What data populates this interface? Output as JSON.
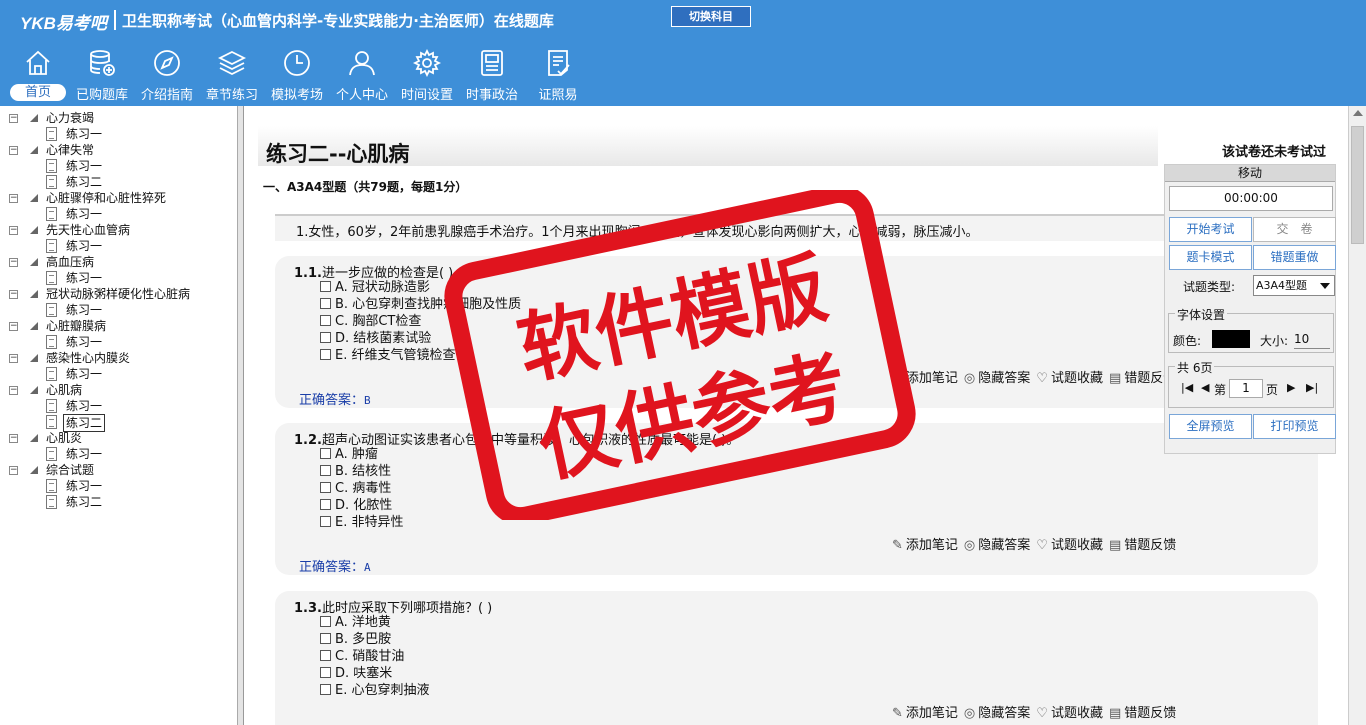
{
  "app": {
    "logo": "YKB易考吧",
    "title": "卫生职称考试（心血管内科学-专业实践能力·主治医师）在线题库",
    "switch_label": "切换科目"
  },
  "nav": [
    {
      "label": "首页",
      "icon": "home-icon"
    },
    {
      "label": "已购题库",
      "icon": "database-icon"
    },
    {
      "label": "介绍指南",
      "icon": "compass-icon"
    },
    {
      "label": "章节练习",
      "icon": "layers-icon"
    },
    {
      "label": "模拟考场",
      "icon": "clock-icon"
    },
    {
      "label": "个人中心",
      "icon": "user-icon"
    },
    {
      "label": "时间设置",
      "icon": "gear-icon"
    },
    {
      "label": "时事政治",
      "icon": "news-icon"
    },
    {
      "label": "证照易",
      "icon": "checklist-icon"
    }
  ],
  "tree": [
    {
      "label": "心力衰竭",
      "children": [
        "练习一"
      ]
    },
    {
      "label": "心律失常",
      "children": [
        "练习一",
        "练习二"
      ]
    },
    {
      "label": "心脏骤停和心脏性猝死",
      "children": [
        "练习一"
      ]
    },
    {
      "label": "先天性心血管病",
      "children": [
        "练习一"
      ]
    },
    {
      "label": "高血压病",
      "children": [
        "练习一"
      ]
    },
    {
      "label": "冠状动脉粥样硬化性心脏病",
      "children": [
        "练习一"
      ]
    },
    {
      "label": "心脏瓣膜病",
      "children": [
        "练习一"
      ]
    },
    {
      "label": "感染性心内膜炎",
      "children": [
        "练习一"
      ]
    },
    {
      "label": "心肌病",
      "children": [
        "练习一",
        "练习二"
      ]
    },
    {
      "label": "心肌炎",
      "children": [
        "练习一"
      ]
    },
    {
      "label": "综合试题",
      "children": [
        "练习一",
        "练习二"
      ]
    }
  ],
  "exam": {
    "title": "练习二--心肌病",
    "status": "该试卷还未考试过",
    "section": "一、A3A4型题（共79题，每题1分）",
    "stem": "1.女性，60岁，2年前患乳腺癌手术治疗。1个月来出现胸闷、气短，查体发现心影向两侧扩大，心音减弱，脉压减小。",
    "questions": [
      {
        "num": "1.1.",
        "text": "进一步应做的检查是( )。",
        "options": [
          "A. 冠状动脉造影",
          "B. 心包穿刺查找肿瘤细胞及性质",
          "C. 胸部CT检查",
          "D. 结核菌素试验",
          "E. 纤维支气管镜检查"
        ],
        "answer": "B"
      },
      {
        "num": "1.2.",
        "text": "超声心动图证实该患者心包呈中等量积液，心包积液的性质最可能是( )。",
        "options": [
          "A. 肿瘤",
          "B. 结核性",
          "C. 病毒性",
          "D. 化脓性",
          "E. 非特异性"
        ],
        "answer": "A"
      },
      {
        "num": "1.3.",
        "text": "此时应采取下列哪项措施？( )",
        "options": [
          "A. 洋地黄",
          "B. 多巴胺",
          "C. 硝酸甘油",
          "D. 呋塞米",
          "E. 心包穿刺抽液"
        ],
        "answer": ""
      }
    ],
    "answer_label": "正确答案：",
    "tools": [
      "添加笔记",
      "隐藏答案",
      "试题收藏",
      "错题反馈"
    ]
  },
  "panel": {
    "header": "移动",
    "timer": "00:00:00",
    "start": "开始考试",
    "submit": "交　卷",
    "card_mode": "题卡模式",
    "redo_wrong": "错题重做",
    "type_label": "试题类型:",
    "type_value": "A3A4型题",
    "font_legend": "字体设置",
    "color_label": "颜色:",
    "size_label": "大小:",
    "size_value": "10",
    "pages_legend": "共 6页",
    "page_prefix": "第",
    "page_value": "1",
    "page_suffix": "页",
    "fullscreen": "全屏预览",
    "print": "打印预览"
  },
  "stamp": {
    "line1": "软件模版",
    "line2": "仅供参考",
    "color": "#e0141e"
  }
}
